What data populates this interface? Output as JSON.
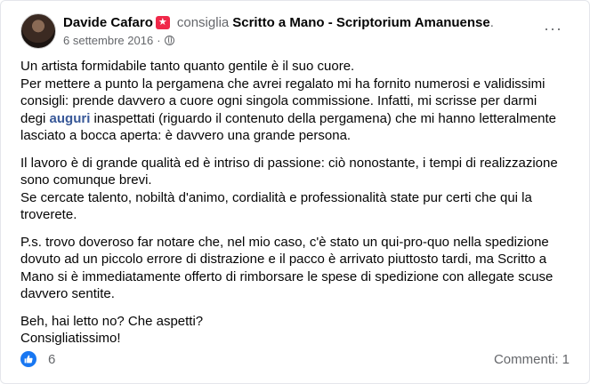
{
  "post": {
    "author": "Davide Cafaro",
    "verb": "consiglia",
    "page": "Scritto a Mano - Scriptorium Amanuense",
    "page_dot": ".",
    "date": "6 settembre 2016",
    "date_sep": "·",
    "more_label": "···",
    "colors": {
      "badge": "#f02849",
      "like": "#1877f2",
      "hashtag": "#385898",
      "meta": "#65676b"
    }
  },
  "body": {
    "p1_l1": "Un artista formidabile tanto quanto gentile è il suo cuore.",
    "p1_l2": "Per mettere a punto la pergamena che avrei regalato mi ha fornito numerosi e validissimi consigli: prende davvero a cuore ogni singola commissione. Infatti, mi scrisse per darmi degi",
    "p1_tag": "auguri",
    "p1_rest": "inaspettati (riguardo il contenuto della pergamena) che mi hanno letteralmente lasciato a bocca aperta: è davvero una grande persona.",
    "p2_l1": "Il lavoro è di grande qualità ed è intriso di passione: ciò nonostante, i tempi di realizzazione sono comunque brevi.",
    "p2_l2": "Se cercate talento, nobiltà d'animo, cordialità e professionalità state pur certi che qui la troverete.",
    "p3": "P.s. trovo doveroso far notare che, nel mio caso, c'è stato un qui-pro-quo nella spedizione dovuto ad un piccolo errore di distrazione e il pacco è arrivato piuttosto tardi, ma Scritto a Mano si è immediatamente offerto di rimborsare le spese di spedizione con allegate scuse davvero sentite.",
    "p4_l1": "Beh, hai letto no? Che aspetti?",
    "p4_l2": "Consigliatissimo!"
  },
  "footer": {
    "like_count": "6",
    "comments": "Commenti: 1"
  }
}
